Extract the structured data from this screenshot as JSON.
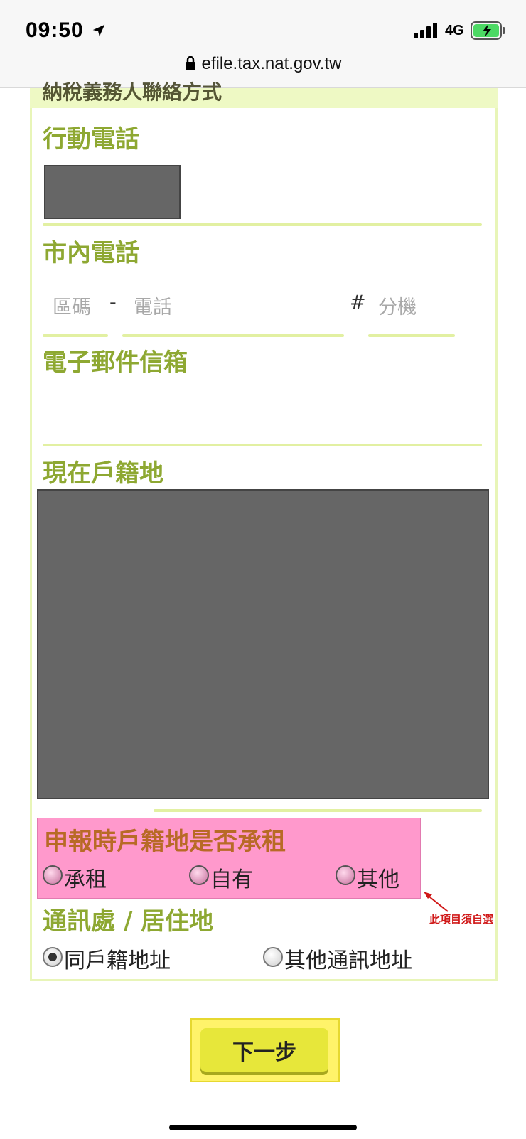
{
  "status_bar": {
    "time": "09:50",
    "network": "4G",
    "url": "efile.tax.nat.gov.tw"
  },
  "form": {
    "section_header": "納稅義務人聯絡方式",
    "mobile": {
      "label": "行動電話"
    },
    "landline": {
      "label": "市內電話",
      "area_code_placeholder": "區碼",
      "separator": "-",
      "phone_placeholder": "電話",
      "extension_symbol": "#",
      "extension_placeholder": "分機"
    },
    "email": {
      "label": "電子郵件信箱",
      "value": ""
    },
    "household": {
      "label": "現在戶籍地"
    },
    "rent": {
      "label": "申報時戶籍地是否承租",
      "options": [
        "承租",
        "自有",
        "其他"
      ],
      "note": "此項目須自選"
    },
    "mailing": {
      "label": "通訊處 / 居住地",
      "options": [
        "同戶籍地址",
        "其他通訊地址"
      ],
      "selected": "同戶籍地址"
    }
  },
  "buttons": {
    "next": "下一步"
  },
  "colors": {
    "label_green": "#8ea832",
    "underline": "#e2f0a2",
    "highlight_pink": "#ff99cc",
    "button_yellow": "#e7e73a",
    "note_red": "#d01818"
  }
}
